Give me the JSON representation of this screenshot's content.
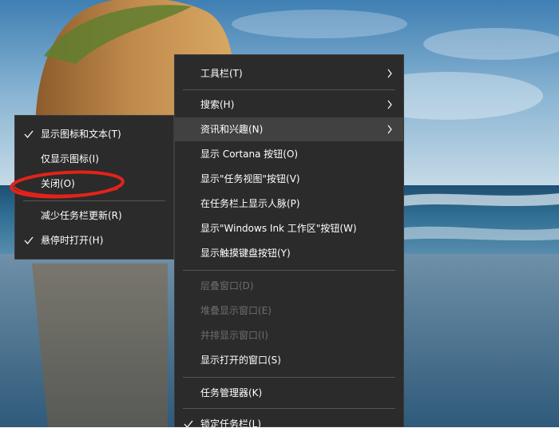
{
  "colors": {
    "menu_bg": "#2b2b2b",
    "menu_text": "#ffffff",
    "disabled_text": "#6d6d6d",
    "hover_bg": "#414141",
    "annotation": "#e2231a"
  },
  "main_menu": {
    "items": [
      {
        "label": "工具栏(T)",
        "has_submenu": true
      },
      {
        "label": "搜索(H)",
        "has_submenu": true
      },
      {
        "label": "资讯和兴趣(N)",
        "has_submenu": true
      },
      {
        "label": "显示 Cortana 按钮(O)"
      },
      {
        "label": "显示\"任务视图\"按钮(V)"
      },
      {
        "label": "在任务栏上显示人脉(P)"
      },
      {
        "label": "显示\"Windows Ink 工作区\"按钮(W)"
      },
      {
        "label": "显示触摸键盘按钮(Y)"
      },
      {
        "label": "层叠窗口(D)",
        "disabled": true
      },
      {
        "label": "堆叠显示窗口(E)",
        "disabled": true
      },
      {
        "label": "并排显示窗口(I)",
        "disabled": true
      },
      {
        "label": "显示打开的窗口(S)"
      },
      {
        "label": "任务管理器(K)"
      },
      {
        "label": "锁定任务栏(L)",
        "checked": true
      }
    ]
  },
  "sub_menu": {
    "items": [
      {
        "label": "显示图标和文本(T)",
        "checked": true
      },
      {
        "label": "仅显示图标(I)"
      },
      {
        "label": "关闭(O)",
        "annotated": true
      },
      {
        "label": "减少任务栏更新(R)"
      },
      {
        "label": "悬停时打开(H)",
        "checked": true
      }
    ]
  }
}
